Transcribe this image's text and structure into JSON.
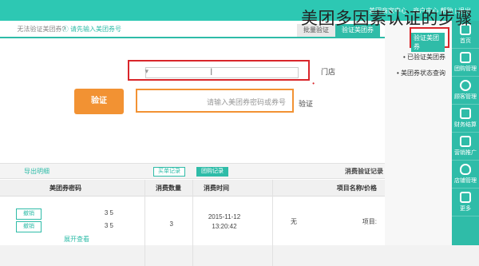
{
  "overlay_title": "美团多因素认证的步骤",
  "topbar": {
    "left_text": "商户中心 帮助 | 退出",
    "mid_text": "美团商家中心"
  },
  "tabs": [
    {
      "label": "验证美团券",
      "active": true
    },
    {
      "label": "批量验证",
      "active": false
    }
  ],
  "toolbar_hint_left": "① 请先输入美团券号",
  "toolbar_hint_right": "无法验证美团券?",
  "sidebar": {
    "active_item": "验证美团券",
    "items": [
      "• 已验证美团券",
      "• 美团券状态查询"
    ]
  },
  "nav": [
    {
      "label": "首页",
      "icon": "home-icon"
    },
    {
      "label": "团购管理",
      "icon": "store-icon"
    },
    {
      "label": "顾客管理",
      "icon": "user-icon"
    },
    {
      "label": "财务结算",
      "icon": "wallet-icon"
    },
    {
      "label": "营销推广",
      "icon": "gift-icon"
    },
    {
      "label": "店铺管理",
      "icon": "fire-icon"
    },
    {
      "label": "更多",
      "icon": "more-icon"
    }
  ],
  "form": {
    "row1_label": "门店",
    "row1_value": "|",
    "code_label": "验证",
    "code_placeholder": "请输入美团券密码或券号",
    "verify_button": "验证"
  },
  "records": {
    "title": "消费验证记录",
    "filter_a": "团购记录",
    "filter_b": "买单记录",
    "export": "导出明细",
    "columns": [
      "项目名称/价格",
      "消费时间",
      "消费数量",
      "美团券密码"
    ],
    "row": {
      "name": "项目:",
      "price": "无",
      "time": "2015-11-12 13:20:42",
      "qty": "3",
      "codes": [
        "3  5",
        "3  5"
      ],
      "code_btn": "撤销",
      "expand": "展开查看"
    }
  },
  "colors": {
    "teal": "#2fbca8",
    "red": "#d9262b",
    "orange": "#f29233"
  }
}
